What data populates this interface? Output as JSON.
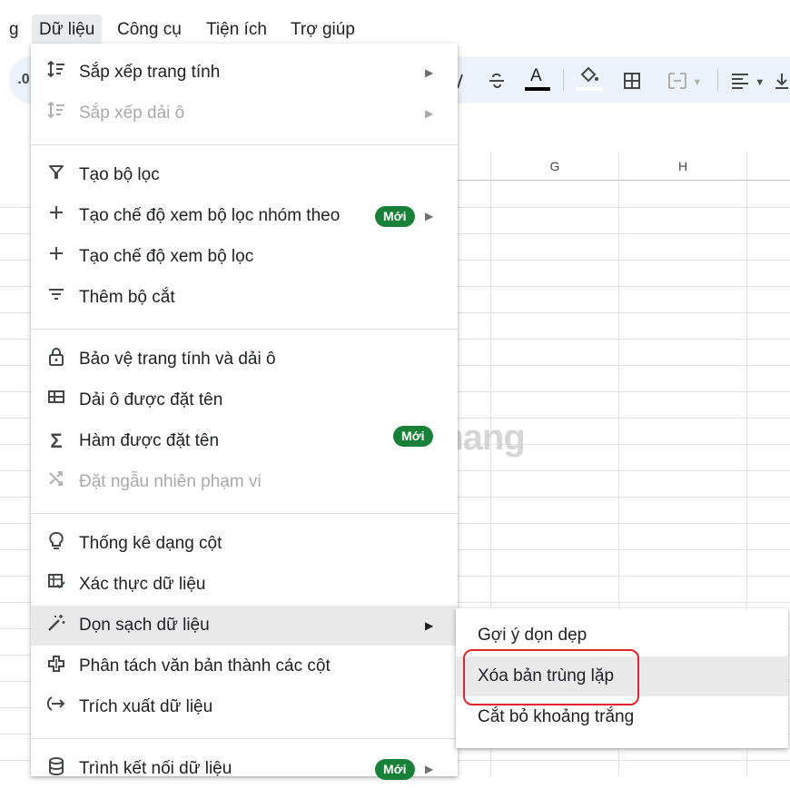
{
  "menubar": {
    "items": [
      {
        "label": "g"
      },
      {
        "label": "Dữ liệu"
      },
      {
        "label": "Công cụ"
      },
      {
        "label": "Tiện ích"
      },
      {
        "label": "Trợ giúp"
      }
    ]
  },
  "toolbar": {
    "decimal_label": ".0",
    "text_color_label": "A",
    "icons": [
      "decimal-icon",
      "text-format-icon",
      "strikethrough-icon",
      "text-color-icon",
      "fill-color-icon",
      "borders-icon",
      "merge-cells-icon",
      "align-icon",
      "vertical-align-icon"
    ]
  },
  "grid": {
    "columns": [
      "G",
      "H"
    ]
  },
  "watermark": {
    "text": "uantrimang"
  },
  "menu": {
    "items": [
      {
        "label": "Sắp xếp trang tính",
        "icon": "sort-icon"
      },
      {
        "label": "Sắp xếp dải ô",
        "icon": "sort-icon"
      },
      {
        "label": "Tạo bộ lọc",
        "icon": "filter-icon"
      },
      {
        "label": "Tạo chế độ xem bộ lọc nhóm theo",
        "icon": "plus-icon",
        "badge": "Mới"
      },
      {
        "label": "Tạo chế độ xem bộ lọc",
        "icon": "plus-icon"
      },
      {
        "label": "Thêm bộ cắt",
        "icon": "slicer-icon"
      },
      {
        "label": "Bảo vệ trang tính và dải ô",
        "icon": "lock-icon"
      },
      {
        "label": "Dải ô được đặt tên",
        "icon": "named-range-icon"
      },
      {
        "label": "Hàm được đặt tên",
        "icon": "sigma-icon",
        "badge": "Mới"
      },
      {
        "label": "Đặt ngẫu nhiên phạm vi",
        "icon": "shuffle-icon"
      },
      {
        "label": "Thống kê dạng cột",
        "icon": "lightbulb-icon"
      },
      {
        "label": "Xác thực dữ liệu",
        "icon": "data-validation-icon"
      },
      {
        "label": "Dọn sạch dữ liệu",
        "icon": "magic-wand-icon"
      },
      {
        "label": "Phân tách văn bản thành các cột",
        "icon": "split-columns-icon"
      },
      {
        "label": "Trích xuất dữ liệu",
        "icon": "extract-icon"
      },
      {
        "label": "Trình kết nối dữ liệu",
        "icon": "database-icon",
        "badge": "Mới"
      }
    ]
  },
  "submenu": {
    "items": [
      {
        "label": "Gợi ý dọn dẹp"
      },
      {
        "label": "Xóa bản trùng lặp"
      },
      {
        "label": "Cắt bỏ khoảng trắng"
      }
    ]
  },
  "colors": {
    "badge": "#188038",
    "highlight_box": "#e0252a",
    "toolbar_bg": "#edf2fa",
    "menu_hover": "#e9e9e9"
  }
}
